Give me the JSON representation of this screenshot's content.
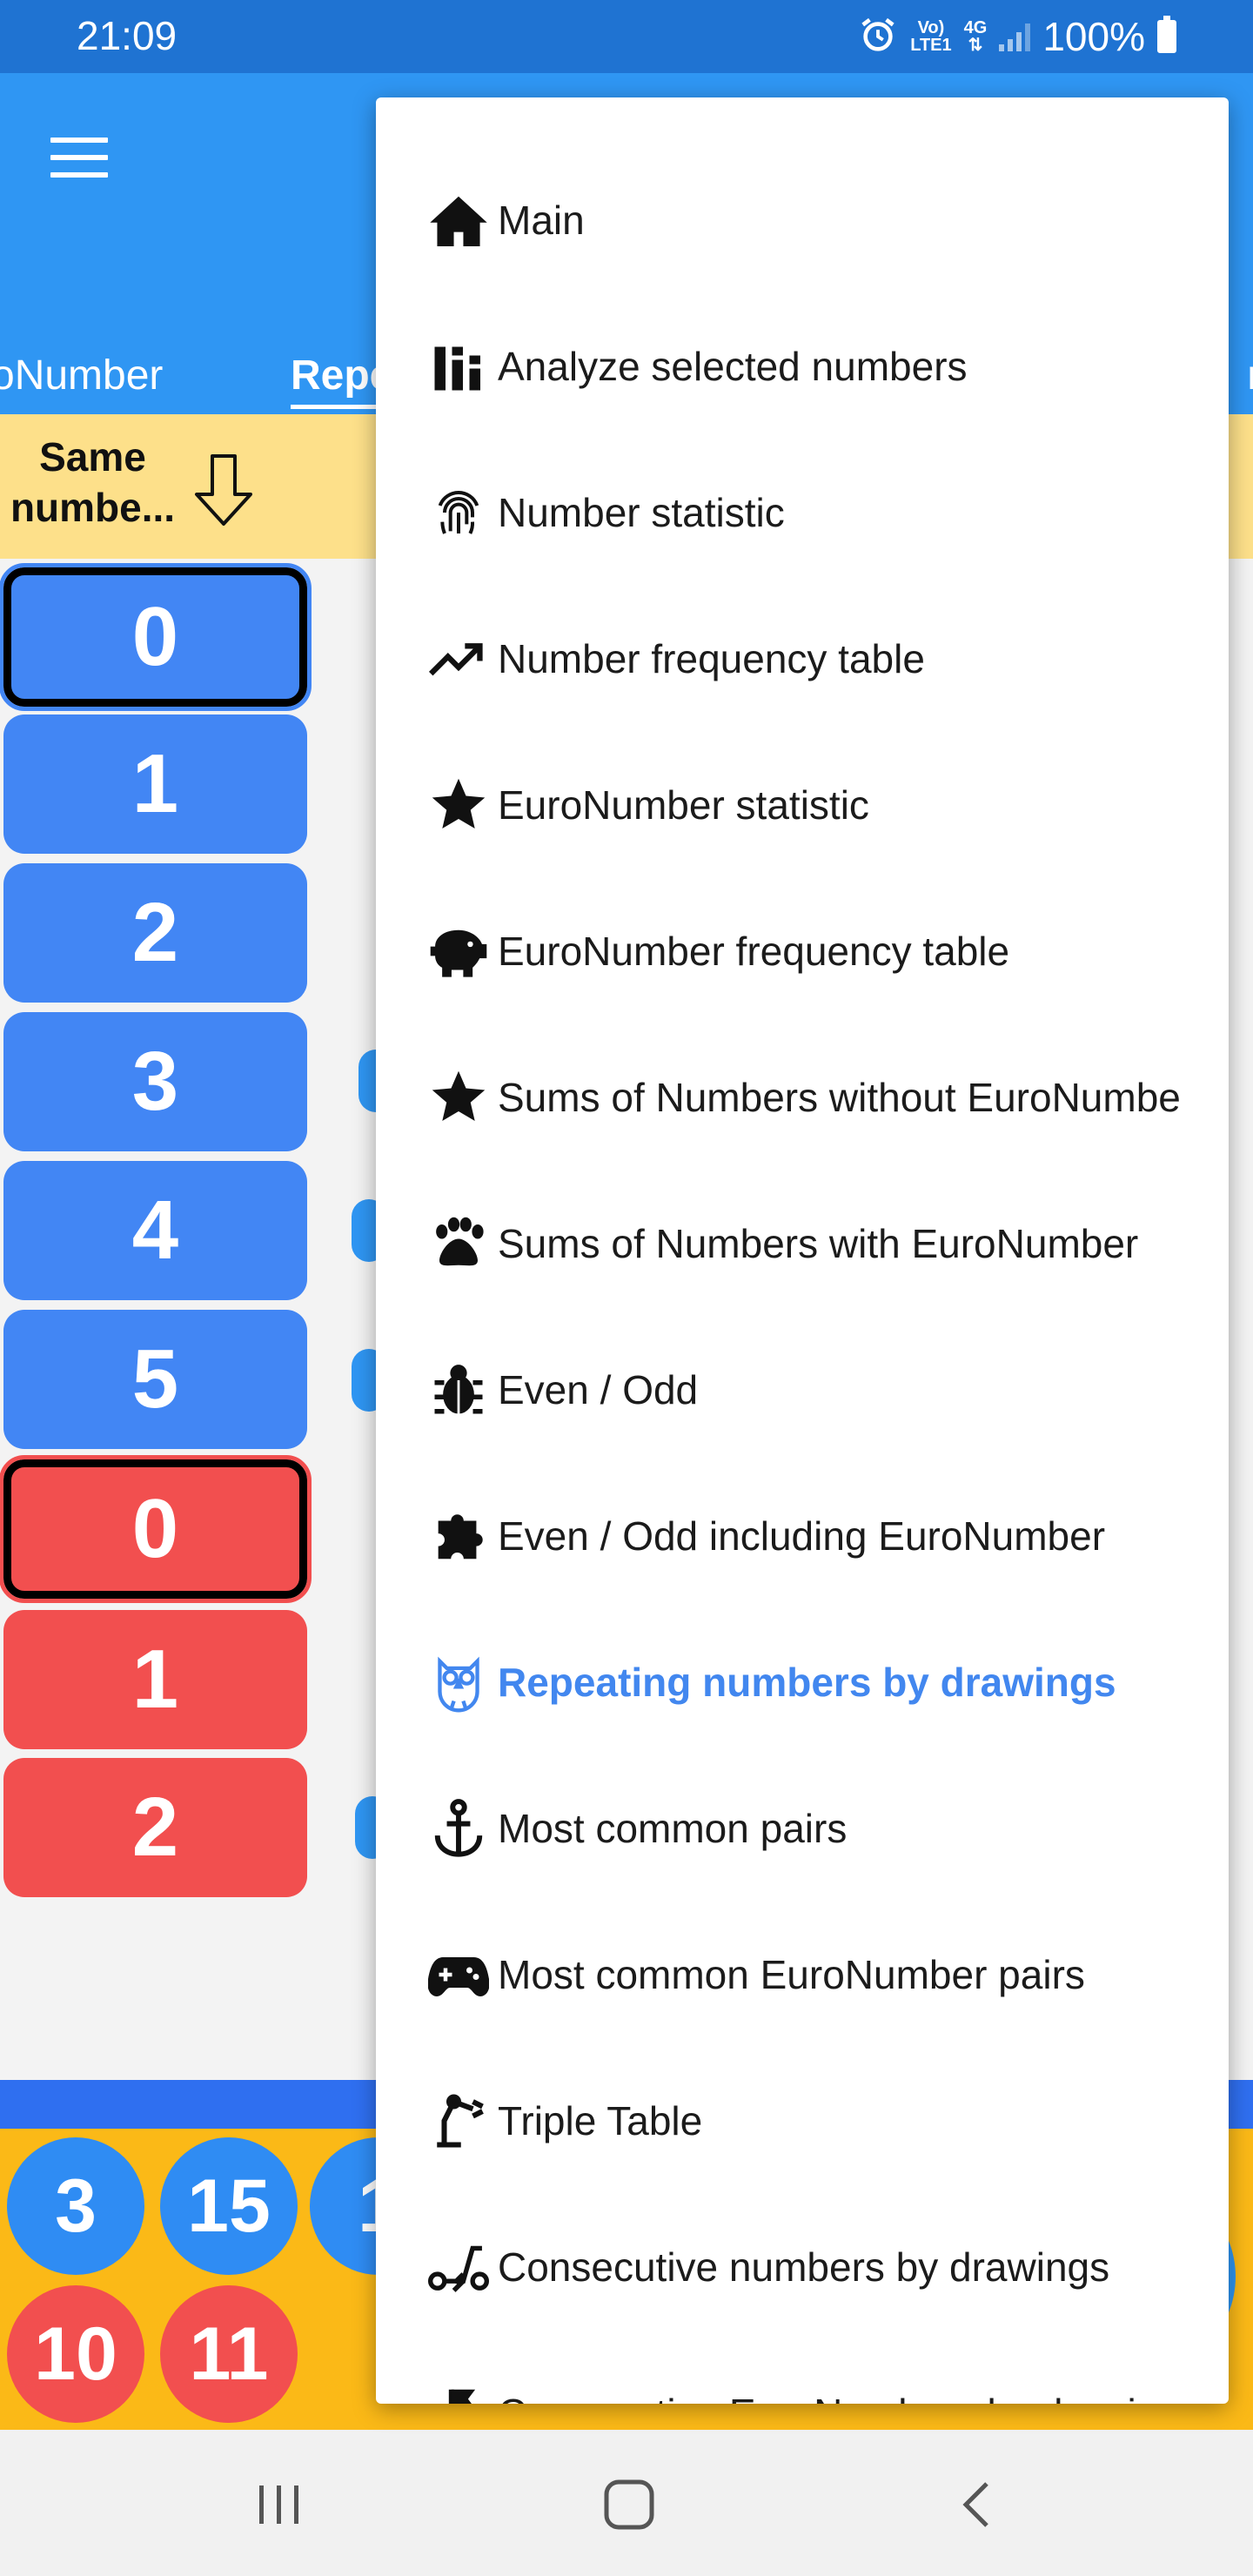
{
  "status_bar": {
    "time": "21:09",
    "network_top": "Vo)",
    "network_bottom": "LTE1",
    "network_type": "4G",
    "battery": "100%"
  },
  "tabs": {
    "prev": "oNumber",
    "active": "Repe",
    "next": "n"
  },
  "table_header": {
    "label": "Same numbe...",
    "sort_icon": "arrow-down-icon"
  },
  "number_buttons": [
    {
      "label": "0",
      "color": "blue",
      "selected": true
    },
    {
      "label": "1",
      "color": "blue",
      "selected": false
    },
    {
      "label": "2",
      "color": "blue",
      "selected": false
    },
    {
      "label": "3",
      "color": "blue",
      "selected": false
    },
    {
      "label": "4",
      "color": "blue",
      "selected": false
    },
    {
      "label": "5",
      "color": "blue",
      "selected": false
    },
    {
      "label": "0",
      "color": "red",
      "selected": true
    },
    {
      "label": "1",
      "color": "red",
      "selected": false
    },
    {
      "label": "2",
      "color": "red",
      "selected": false
    }
  ],
  "bottom_balls": {
    "blue": [
      "3",
      "15",
      "1"
    ],
    "red": [
      "10",
      "11"
    ]
  },
  "menu": {
    "items": [
      {
        "label": "Main",
        "icon": "home-icon",
        "active": false
      },
      {
        "label": "Analyze selected numbers",
        "icon": "bar-chart-icon",
        "active": false
      },
      {
        "label": "Number statistic",
        "icon": "fingerprint-icon",
        "active": false
      },
      {
        "label": "Number frequency table",
        "icon": "trending-up-icon",
        "active": false
      },
      {
        "label": "EuroNumber statistic",
        "icon": "star-icon",
        "active": false
      },
      {
        "label": "EuroNumber frequency table",
        "icon": "piggy-bank-icon",
        "active": false
      },
      {
        "label": "Sums of Numbers without EuroNumbe",
        "icon": "star-icon",
        "active": false
      },
      {
        "label": "Sums of Numbers with EuroNumber",
        "icon": "paw-icon",
        "active": false
      },
      {
        "label": "Even / Odd",
        "icon": "bug-icon",
        "active": false
      },
      {
        "label": "Even / Odd including EuroNumber",
        "icon": "puzzle-icon",
        "active": false
      },
      {
        "label": "Repeating numbers by drawings",
        "icon": "owl-icon",
        "active": true
      },
      {
        "label": "Most common pairs",
        "icon": "anchor-icon",
        "active": false
      },
      {
        "label": "Most common EuroNumber pairs",
        "icon": "gamepad-icon",
        "active": false
      },
      {
        "label": "Triple Table",
        "icon": "robot-arm-icon",
        "active": false
      },
      {
        "label": "Consecutive numbers by drawings",
        "icon": "scooter-icon",
        "active": false
      },
      {
        "label": "Consecutive EuroNumbers by drawings",
        "icon": "flag-icon",
        "active": false
      }
    ]
  },
  "colors": {
    "status_bar": "#1f73d2",
    "app_bar": "#2f96f3",
    "header_row": "#fde08a",
    "blue_button": "#4286f4",
    "red_button": "#f24f4f",
    "bottom_panel": "#fbb917",
    "menu_active": "#4287ef"
  }
}
